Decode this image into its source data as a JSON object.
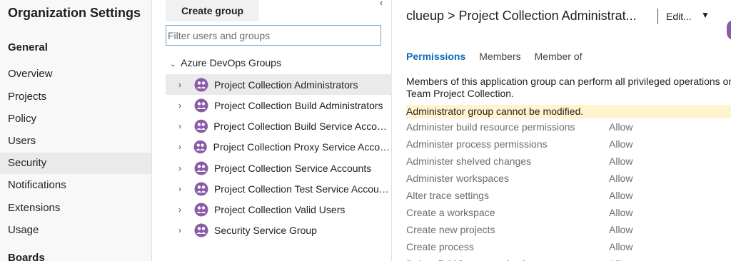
{
  "nav": {
    "title": "Organization Settings",
    "section_general": "General",
    "items": [
      {
        "label": "Overview"
      },
      {
        "label": "Projects"
      },
      {
        "label": "Policy"
      },
      {
        "label": "Users"
      },
      {
        "label": "Security"
      },
      {
        "label": "Notifications"
      },
      {
        "label": "Extensions"
      },
      {
        "label": "Usage"
      }
    ],
    "selected": "Security",
    "section_boards": "Boards"
  },
  "groups_panel": {
    "create_button": "Create group",
    "filter_placeholder": "Filter users and groups",
    "group_header": "Azure DevOps Groups",
    "rows": [
      {
        "label": "Project Collection Administrators"
      },
      {
        "label": "Project Collection Build Administrators"
      },
      {
        "label": "Project Collection Build Service Accounts"
      },
      {
        "label": "Project Collection Proxy Service Accounts"
      },
      {
        "label": "Project Collection Service Accounts"
      },
      {
        "label": "Project Collection Test Service Accounts"
      },
      {
        "label": "Project Collection Valid Users"
      },
      {
        "label": "Security Service Group"
      }
    ],
    "selected": "Project Collection Administrators",
    "icon_color": "#8a5ca8"
  },
  "detail": {
    "breadcrumb": "clueup > Project Collection Administrat...",
    "edit_label": "Edit...",
    "tabs": [
      {
        "label": "Permissions"
      },
      {
        "label": "Members"
      },
      {
        "label": "Member of"
      }
    ],
    "active_tab": "Permissions",
    "description_line1": "Members of this application group can perform all privileged operations on the",
    "description_line2": "Team Project Collection.",
    "warning": "Administrator group cannot be modified.",
    "permissions": [
      {
        "name": "Administer build resource permissions",
        "value": "Allow"
      },
      {
        "name": "Administer process permissions",
        "value": "Allow"
      },
      {
        "name": "Administer shelved changes",
        "value": "Allow"
      },
      {
        "name": "Administer workspaces",
        "value": "Allow"
      },
      {
        "name": "Alter trace settings",
        "value": "Allow"
      },
      {
        "name": "Create a workspace",
        "value": "Allow"
      },
      {
        "name": "Create new projects",
        "value": "Allow"
      },
      {
        "name": "Create process",
        "value": "Allow"
      },
      {
        "name": "Delete field from organization",
        "value": "Allow"
      }
    ]
  },
  "colors": {
    "accent": "#0f6cbd",
    "warning_bg": "#fff4ce",
    "selected_bg": "#eaeaea"
  }
}
